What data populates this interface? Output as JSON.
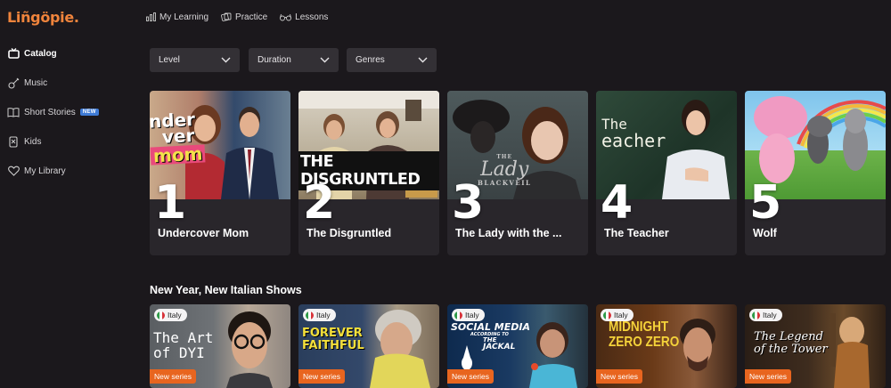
{
  "app": {
    "logo": "Liñgöpie."
  },
  "sidebar": {
    "items": [
      {
        "label": "Catalog",
        "icon": "tv-icon"
      },
      {
        "label": "Music",
        "icon": "guitar-icon"
      },
      {
        "label": "Short Stories",
        "icon": "book-icon",
        "badge": "NEW"
      },
      {
        "label": "Kids",
        "icon": "kids-icon"
      },
      {
        "label": "My Library",
        "icon": "heart-icon"
      }
    ]
  },
  "topnav": [
    {
      "label": "My Learning",
      "icon": "chart-icon"
    },
    {
      "label": "Practice",
      "icon": "cards-icon"
    },
    {
      "label": "Lessons",
      "icon": "glasses-icon"
    }
  ],
  "filters": [
    {
      "label": "Level"
    },
    {
      "label": "Duration"
    },
    {
      "label": "Genres"
    }
  ],
  "top_shows": [
    {
      "rank": "1",
      "title": "Undercover Mom",
      "poster_text": [
        "nder",
        "ver",
        "mom"
      ]
    },
    {
      "rank": "2",
      "title": "The Disgruntled",
      "poster_text": "THE DISGRUNTLED"
    },
    {
      "rank": "3",
      "title": "The Lady with the ...",
      "poster_text": [
        "THE",
        "Lady",
        "BLACKVEIL"
      ]
    },
    {
      "rank": "4",
      "title": "The Teacher",
      "poster_text": [
        "The",
        "eacher"
      ]
    },
    {
      "rank": "5",
      "title": "Wolf"
    }
  ],
  "section": {
    "title": "New Year, New Italian Shows",
    "cards": [
      {
        "country": "Italy",
        "badge": "New series",
        "poster_text": [
          "The Art",
          "of DYI"
        ]
      },
      {
        "country": "Italy",
        "badge": "New series",
        "poster_text": [
          "FOREVER",
          "FAITHFUL"
        ]
      },
      {
        "country": "Italy",
        "badge": "New series",
        "poster_text": [
          "SOCIAL MEDIA",
          "ACCORDING TO",
          "THE",
          "JACKAL"
        ]
      },
      {
        "country": "Italy",
        "badge": "New series",
        "poster_text": [
          "MIDNIGHT",
          "ZERO ZERO"
        ]
      },
      {
        "country": "Italy",
        "badge": "New series",
        "poster_text": [
          "The Legend",
          "of the Tower"
        ]
      }
    ]
  },
  "colors": {
    "accent": "#f0843c",
    "new_badge": "#3f7bd6",
    "series_badge": "#e8651f",
    "background": "#1b181c"
  }
}
